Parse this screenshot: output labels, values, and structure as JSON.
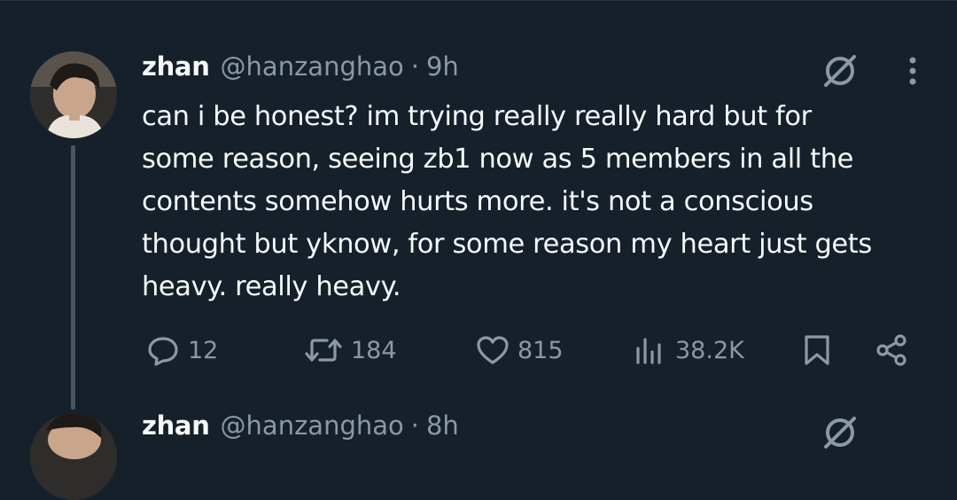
{
  "tweet": {
    "display_name": "zhan",
    "handle": "@hanzanghao",
    "separator": "·",
    "time": "9h",
    "text_lines": [
      "can i be honest? im trying really really hard but for",
      "some reason, seeing zb1 now as 5 members in all the",
      "contents somehow hurts more. it's not a conscious",
      "thought but yknow, for some reason my heart just gets",
      "heavy. really heavy."
    ],
    "replies": "12",
    "reposts": "184",
    "likes": "815",
    "views": "38.2K"
  },
  "next_tweet": {
    "display_name": "zhan",
    "handle": "@hanzanghao",
    "separator": "·",
    "time": "8h"
  },
  "icons": {
    "reply": "reply-icon",
    "repost": "repost-icon",
    "like": "heart-icon",
    "views": "views-icon",
    "bookmark": "bookmark-icon",
    "share": "share-icon",
    "grok": "grok-icon",
    "more": "more-icon"
  },
  "colors": {
    "background": "#15202b",
    "text": "#f7f9f9",
    "muted": "#8b98a5",
    "thread_line": "#4a5561"
  }
}
